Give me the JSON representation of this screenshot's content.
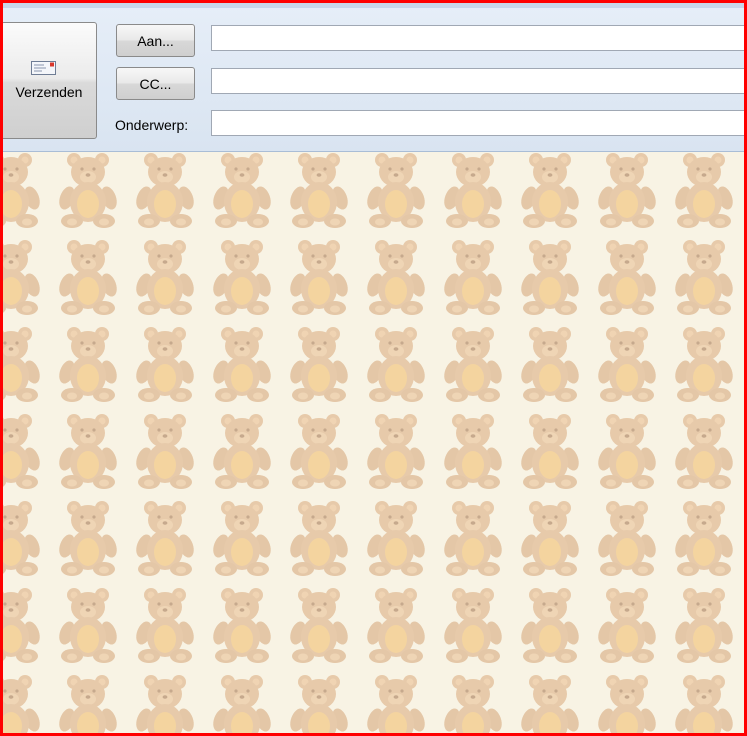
{
  "compose": {
    "send_label": "Verzenden",
    "to_button_label": "Aan...",
    "cc_button_label": "CC...",
    "subject_label": "Onderwerp:",
    "to_value": "",
    "cc_value": "",
    "subject_value": ""
  },
  "body": {
    "stationery": "teddy-bear-pattern",
    "background_color": "#f8f3e4"
  },
  "icons": {
    "send": "envelope-icon",
    "pattern": "teddy-bear-icon"
  },
  "colors": {
    "frame_border": "#ff0000",
    "header_bg": "#dfe8f3"
  }
}
